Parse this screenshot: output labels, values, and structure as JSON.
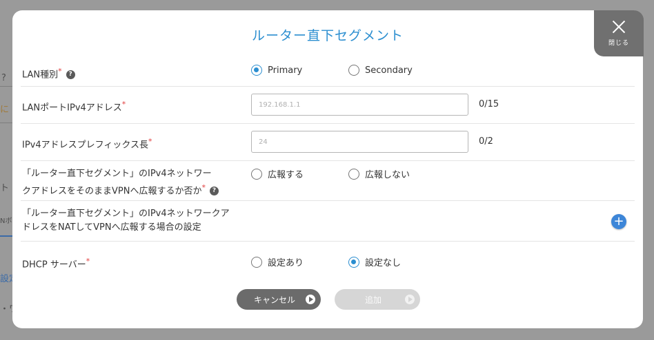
{
  "background": {
    "fragments": [
      "に",
      "ト",
      "Nボ",
      "設定",
      "・ワ"
    ]
  },
  "dialog": {
    "title": "ルーター直下セグメント",
    "close_label": "閉じる",
    "rows": {
      "lan_type": {
        "label": "LAN種別",
        "required_mark": "*",
        "options": [
          "Primary",
          "Secondary"
        ],
        "selected": "Primary"
      },
      "lan_port_ipv4": {
        "label": "LANポートIPv4アドレス",
        "required_mark": "*",
        "placeholder": "192.168.1.1",
        "counter": "0/15"
      },
      "ipv4_prefix": {
        "label": "IPv4アドレスプレフィックス長",
        "required_mark": "*",
        "placeholder": "24",
        "counter": "0/2"
      },
      "advertise_vpn": {
        "label_line1": "「ルーター直下セグメント」のIPv4ネットワー",
        "label_line2": "クアドレスをそのままVPNへ広報するか否か",
        "required_mark": "*",
        "options": [
          "広報する",
          "広報しない"
        ],
        "selected": ""
      },
      "nat_vpn": {
        "label_line1": "「ルーター直下セグメント」のIPv4ネットワークア",
        "label_line2": "ドレスをNATしてVPNへ広報する場合の設定"
      },
      "dhcp_server": {
        "label": "DHCP サーバー",
        "required_mark": "*",
        "options": [
          "設定あり",
          "設定なし"
        ],
        "selected": "設定なし"
      }
    },
    "buttons": {
      "cancel": "キャンセル",
      "add": "追加"
    },
    "colors": {
      "accent": "#2b8ed0",
      "required": "#e03c3c",
      "cancel_button": "#6b6b6b",
      "add_button_disabled": "#d6d6d6"
    }
  }
}
